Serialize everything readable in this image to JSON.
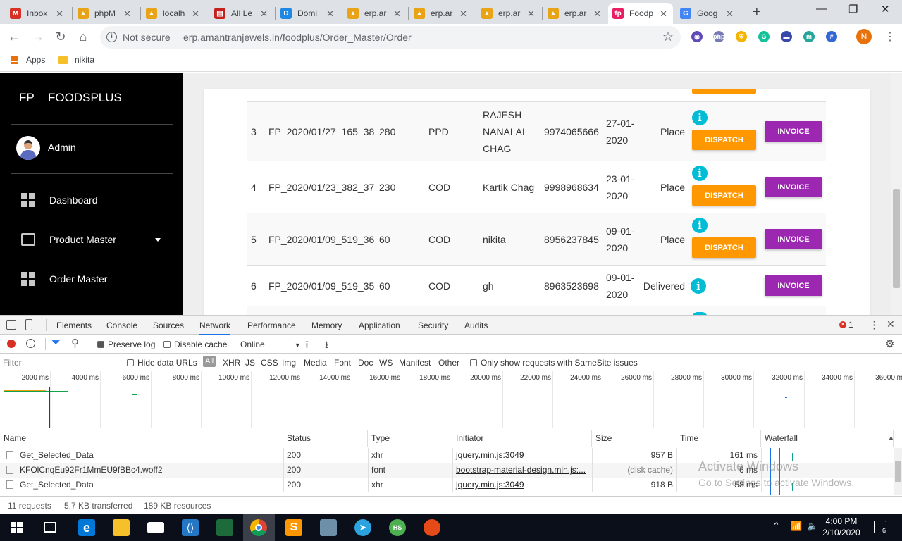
{
  "browser": {
    "tabs": [
      {
        "label": "Inbox",
        "icon": "gmail-icon",
        "color": "#d93025",
        "glyph": "M"
      },
      {
        "label": "phpM",
        "icon": "pma-icon",
        "color": "#e8a317",
        "glyph": "▲"
      },
      {
        "label": "localh",
        "icon": "pma-icon",
        "color": "#e8a317",
        "glyph": "▲"
      },
      {
        "label": "All Le",
        "icon": "pdf-icon",
        "color": "#c5221f",
        "glyph": "▤"
      },
      {
        "label": "Domi",
        "icon": "dominate-icon",
        "color": "#1e88e5",
        "glyph": "D"
      },
      {
        "label": "erp.ar",
        "icon": "pma-icon",
        "color": "#e8a317",
        "glyph": "▲"
      },
      {
        "label": "erp.ar",
        "icon": "pma-icon",
        "color": "#e8a317",
        "glyph": "▲"
      },
      {
        "label": "erp.ar",
        "icon": "pma-icon",
        "color": "#e8a317",
        "glyph": "▲"
      },
      {
        "label": "erp.ar",
        "icon": "pma-icon",
        "color": "#e8a317",
        "glyph": "▲"
      },
      {
        "label": "Foodp",
        "icon": "foodplus-icon",
        "color": "#e91e63",
        "glyph": "fp",
        "active": true
      },
      {
        "label": "Goog",
        "icon": "google-icon",
        "color": "#4285f4",
        "glyph": "G"
      }
    ],
    "omnibox": {
      "security": "Not secure",
      "url": "erp.amantranjewels.in/foodplus/Order_Master/Order"
    },
    "bookmarks": [
      {
        "label": "Apps",
        "icon": "apps-grid-icon"
      },
      {
        "label": "nikita",
        "icon": "folder-icon"
      }
    ],
    "profile_initial": "N",
    "extensions": [
      {
        "name": "chrome-ext-icon",
        "color": "#5f4bb6",
        "glyph": "◉"
      },
      {
        "name": "php-ext-icon",
        "color": "#777bb3",
        "glyph": "php"
      },
      {
        "name": "shield-ext-icon",
        "color": "#f4b400",
        "glyph": "⛨"
      },
      {
        "name": "grammarly-ext-icon",
        "color": "#15c39a",
        "glyph": "G"
      },
      {
        "name": "media-ext-icon",
        "color": "#3949ab",
        "glyph": "▬"
      },
      {
        "name": "m-ext-icon",
        "color": "#26a69a",
        "glyph": "m"
      },
      {
        "name": "hash-ext-icon",
        "color": "#3367d6",
        "glyph": "#"
      }
    ]
  },
  "app": {
    "logo_mini": "FP",
    "logo_name": "FOODSPLUS",
    "user": "Admin",
    "nav": [
      {
        "label": "Dashboard",
        "icon": "dashboard-icon"
      },
      {
        "label": "Product Master",
        "icon": "gallery-icon",
        "has_caret": true
      },
      {
        "label": "Order Master",
        "icon": "dashboard-icon"
      }
    ],
    "orders": [
      {
        "no": "3",
        "order_id": "FP_2020/01/27_165_38",
        "amount": "280",
        "payment": "PPD",
        "name": [
          "RAJESH",
          "NANALAL",
          "CHAG"
        ],
        "phone": "9974065666",
        "date": [
          "27-01-",
          "2020"
        ],
        "status": "Place",
        "dispatch": "DISPATCH",
        "invoice": "INVOICE"
      },
      {
        "no": "4",
        "order_id": "FP_2020/01/23_382_37",
        "amount": "230",
        "payment": "COD",
        "name": [
          "Kartik Chag"
        ],
        "phone": "9998968634",
        "date": [
          "23-01-",
          "2020"
        ],
        "status": "Place",
        "dispatch": "DISPATCH",
        "invoice": "INVOICE"
      },
      {
        "no": "5",
        "order_id": "FP_2020/01/09_519_36",
        "amount": "60",
        "payment": "COD",
        "name": [
          "nikita"
        ],
        "phone": "8956237845",
        "date": [
          "09-01-",
          "2020"
        ],
        "status": "Place",
        "dispatch": "DISPATCH",
        "invoice": "INVOICE"
      },
      {
        "no": "6",
        "order_id": "FP_2020/01/09_519_35",
        "amount": "60",
        "payment": "COD",
        "name": [
          "gh"
        ],
        "phone": "8963523698",
        "date": [
          "09-01-",
          "2020"
        ],
        "status": "Delivered",
        "dispatch": "",
        "invoice": "INVOICE"
      }
    ],
    "colors": {
      "dispatch": "#ff9800",
      "invoice": "#9c27b0",
      "info": "#00bcd4"
    }
  },
  "devtools": {
    "tabs": [
      "Elements",
      "Console",
      "Sources",
      "Network",
      "Performance",
      "Memory",
      "Application",
      "Security",
      "Audits"
    ],
    "active_tab": "Network",
    "error_count": "1",
    "toolbar": {
      "preserve_log": "Preserve log",
      "disable_cache": "Disable cache",
      "throttle": "Online"
    },
    "filter": {
      "placeholder": "Filter",
      "hide_data_urls": "Hide data URLs",
      "types": [
        "All",
        "XHR",
        "JS",
        "CSS",
        "Img",
        "Media",
        "Font",
        "Doc",
        "WS",
        "Manifest",
        "Other"
      ],
      "samesite": "Only show requests with SameSite issues"
    },
    "timeline_ticks": [
      "2000 ms",
      "4000 ms",
      "6000 ms",
      "8000 ms",
      "10000 ms",
      "12000 ms",
      "14000 ms",
      "16000 ms",
      "18000 ms",
      "20000 ms",
      "22000 ms",
      "24000 ms",
      "26000 ms",
      "28000 ms",
      "30000 ms",
      "32000 ms",
      "34000 ms",
      "36000 m"
    ],
    "columns": [
      "Name",
      "Status",
      "Type",
      "Initiator",
      "Size",
      "Time",
      "Waterfall"
    ],
    "requests": [
      {
        "name": "Get_Selected_Data",
        "status": "200",
        "type": "xhr",
        "initiator": "jquery.min.js:3049",
        "size": "957 B",
        "time": "161 ms"
      },
      {
        "name": "KFOlCnqEu92Fr1MmEU9fBBc4.woff2",
        "status": "200",
        "type": "font",
        "initiator": "bootstrap-material-design.min.js:...",
        "size": "(disk cache)",
        "time": "6 ms"
      },
      {
        "name": "Get_Selected_Data",
        "status": "200",
        "type": "xhr",
        "initiator": "jquery.min.js:3049",
        "size": "918 B",
        "time": "58 ms"
      }
    ],
    "summary": {
      "requests": "11 requests",
      "transferred": "5.7 KB transferred",
      "resources": "189 KB resources"
    }
  },
  "watermark": {
    "line1": "Activate Windows",
    "line2": "Go to Settings to activate Windows."
  },
  "taskbar": {
    "time": "4:00 PM",
    "date": "2/10/2020",
    "notifications": "6"
  }
}
